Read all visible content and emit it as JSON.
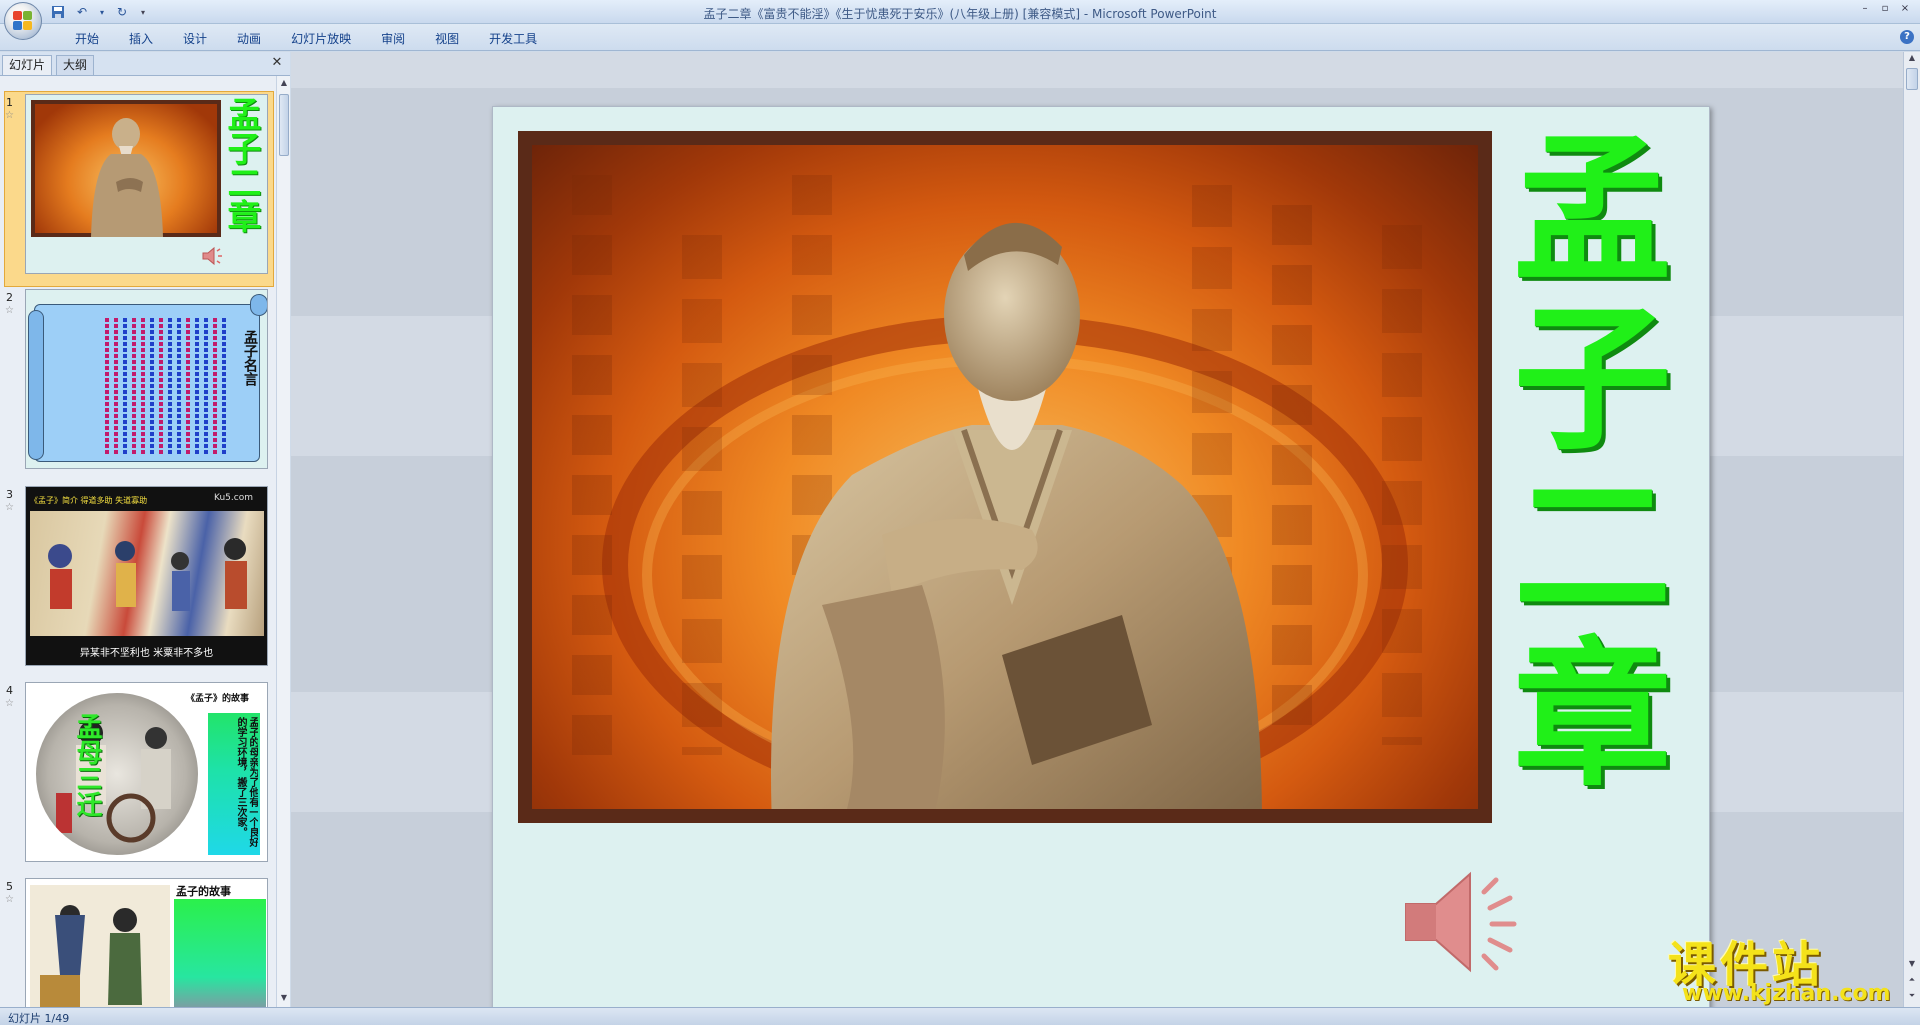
{
  "window": {
    "title": "孟子二章《富贵不能淫》《生于忧患死于安乐》(八年级上册) [兼容模式]",
    "app_suffix": " - Microsoft PowerPoint"
  },
  "ribbon": {
    "tabs": [
      "开始",
      "插入",
      "设计",
      "动画",
      "幻灯片放映",
      "审阅",
      "视图",
      "开发工具"
    ]
  },
  "left_pane": {
    "tab_slides": "幻灯片",
    "tab_outline": "大纲",
    "thumbnails": [
      {
        "num": "1",
        "title": "孟子二章"
      },
      {
        "num": "2",
        "title": "孟子名言"
      },
      {
        "num": "3",
        "banner": "《孟子》简介  得道多助  失道寡助",
        "site": "Ku5.com",
        "caption": "异某非不坚利也  米粟非不多也"
      },
      {
        "num": "4",
        "heading": "《孟子》的故事",
        "side": "孟母三迁",
        "text": "孟子的母亲为了他有一个良好的学习环境，搬了三次家。"
      },
      {
        "num": "5",
        "heading": "孟子的故事"
      }
    ]
  },
  "slide": {
    "title_vertical": "孟子二章"
  },
  "statusbar": {
    "slide_info": "幻灯片 1/49"
  },
  "watermark": {
    "cn": "课件站",
    "url": "www.kjzhan.com"
  },
  "colors": {
    "title_green": "#20f018",
    "ribbon_text": "#15428b",
    "selection": "#fbd98b"
  }
}
